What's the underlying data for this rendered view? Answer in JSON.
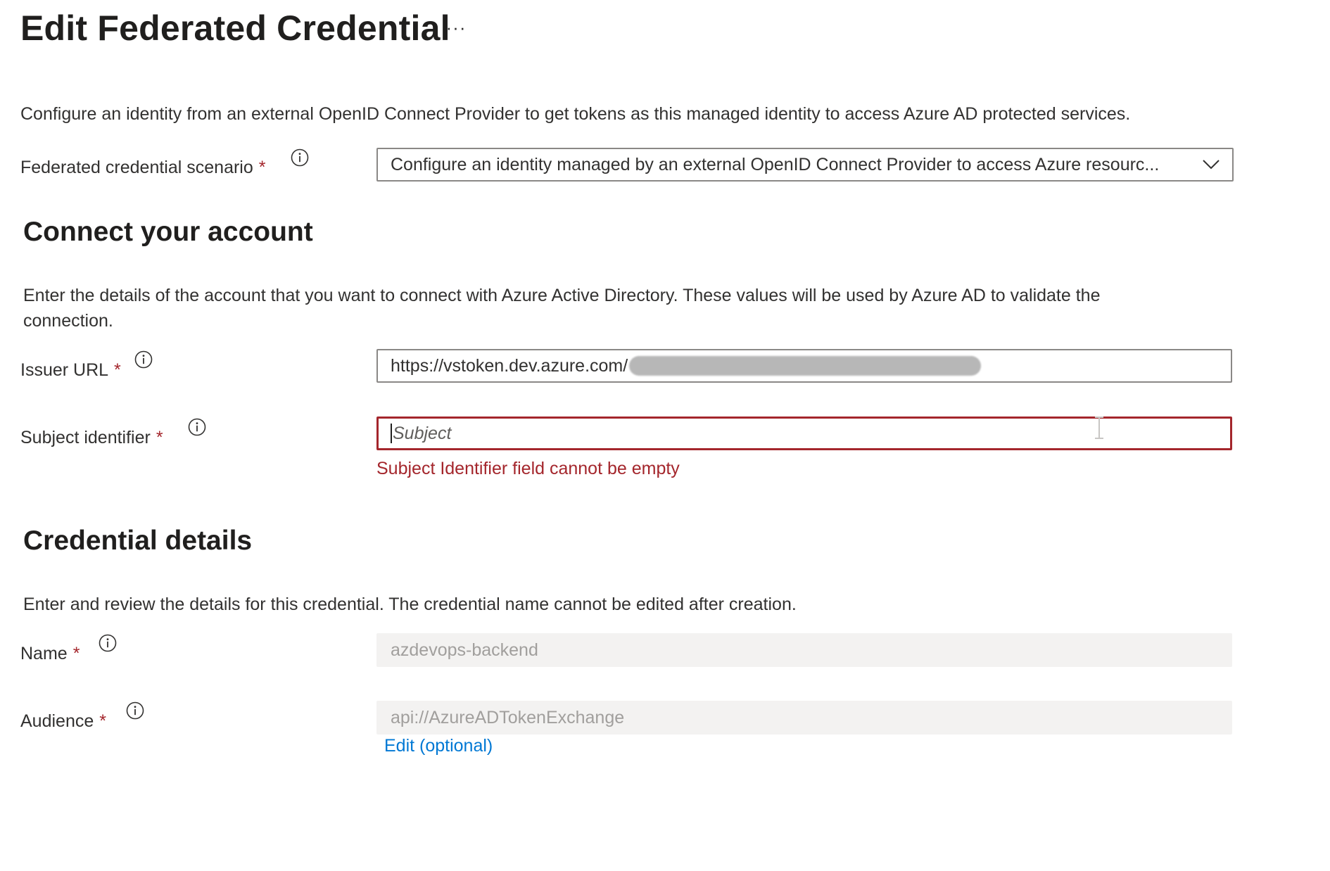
{
  "header": {
    "title": "Edit Federated Credential",
    "more_label": "···"
  },
  "intro": {
    "description": "Configure an identity from an external OpenID Connect Provider to get tokens as this managed identity to access Azure AD protected services."
  },
  "scenario": {
    "label": "Federated credential scenario",
    "required_mark": "*",
    "value": "Configure an identity managed by an external OpenID Connect Provider to access Azure resourc..."
  },
  "connect": {
    "title": "Connect your account",
    "description": "Enter the details of the account that you want to connect with Azure Active Directory. These values will be used by Azure AD to validate the connection.",
    "issuer": {
      "label": "Issuer URL",
      "required_mark": "*",
      "value": "https://vstoken.dev.azure.com/"
    },
    "subject": {
      "label": "Subject identifier",
      "required_mark": "*",
      "placeholder": "Subject",
      "error": "Subject Identifier field cannot be empty"
    }
  },
  "credential": {
    "title": "Credential details",
    "description": "Enter and review the details for this credential. The credential name cannot be edited after creation.",
    "name": {
      "label": "Name",
      "required_mark": "*",
      "value": "azdevops-backend"
    },
    "audience": {
      "label": "Audience",
      "required_mark": "*",
      "value": "api://AzureADTokenExchange",
      "edit_link": "Edit (optional)"
    }
  },
  "colors": {
    "error": "#a4262c",
    "link": "#0078d4",
    "disabled_bg": "#f3f2f1",
    "border": "#8a8886"
  }
}
